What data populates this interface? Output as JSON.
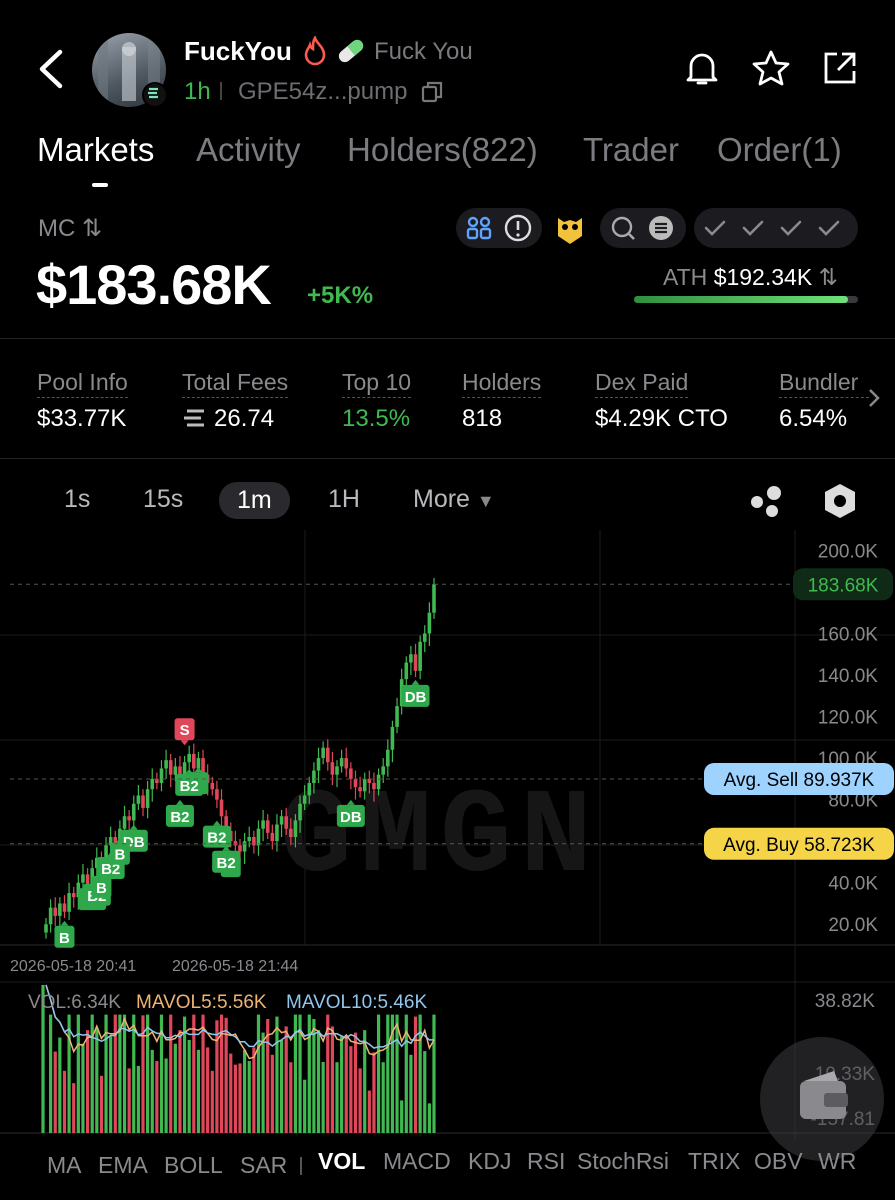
{
  "header": {
    "token_name": "FuckYou",
    "token_full_name": "Fuck You",
    "age": "1h",
    "address": "GPE54z...pump",
    "icons": [
      "back-arrow-icon",
      "bell-icon",
      "star-icon",
      "share-icon",
      "fire-icon",
      "pill-icon",
      "copy-icon",
      "solana-icon"
    ]
  },
  "tabs": [
    "Markets",
    "Activity",
    "Holders(822)",
    "Trader",
    "Order(1)"
  ],
  "market": {
    "mc_label": "MC",
    "mc_value": "$183.68K",
    "mc_change": "+5K%",
    "ath_label": "ATH",
    "ath_value": "$192.34K",
    "ath_progress": 0.955
  },
  "stats": [
    {
      "label": "Pool Info",
      "value": "$33.77K"
    },
    {
      "label": "Total Fees",
      "value": "26.74"
    },
    {
      "label": "Top 10",
      "value": "13.5%"
    },
    {
      "label": "Holders",
      "value": "818"
    },
    {
      "label": "Dex Paid",
      "value": "$4.29K CTO"
    },
    {
      "label": "Bundler",
      "value": "6.54%"
    }
  ],
  "timeframes": [
    "1s",
    "15s",
    "1m",
    "1H",
    "More"
  ],
  "active_timeframe": "1m",
  "chart_labels": {
    "current_price": "183.68K",
    "avg_sell": "Avg. Sell 89.937K",
    "avg_buy": "Avg. Buy 58.723K",
    "x_ticks": [
      "2026-05-18 20:41",
      "2026-05-18 21:44"
    ],
    "watermark": "GMGN",
    "vol_legend": {
      "vol": "VOL:6.34K",
      "mavol5": "MAVOL5:5.56K",
      "mavol10": "MAVOL10:5.46K"
    },
    "vol_axis": [
      "38.82K",
      "19.33K",
      "-157.81"
    ]
  },
  "indicators": [
    "MA",
    "EMA",
    "BOLL",
    "SAR",
    "VOL",
    "MACD",
    "KDJ",
    "RSI",
    "StochRsi",
    "TRIX",
    "OBV",
    "WR"
  ],
  "active_indicator": "VOL",
  "colors": {
    "up": "#3fb950",
    "down": "#e0475a",
    "accent_green": "#3fb950",
    "avg_sell": "#9fd3ff",
    "avg_buy": "#f5d547"
  },
  "chart_data": {
    "type": "candlestick",
    "y_ticks": [
      "200.0K",
      "160.0K",
      "140.0K",
      "120.0K",
      "100.0K",
      "80.0K",
      "40.0K",
      "20.0K"
    ],
    "ylim": [
      10,
      205
    ],
    "close_series": [
      20,
      28,
      24,
      30,
      26,
      35,
      33,
      40,
      44,
      38,
      47,
      52,
      50,
      58,
      62,
      55,
      66,
      72,
      70,
      78,
      82,
      76,
      85,
      90,
      88,
      95,
      99,
      92,
      96,
      90,
      98,
      102,
      95,
      100,
      92,
      88,
      85,
      80,
      72,
      65,
      60,
      58,
      55,
      60,
      62,
      58,
      66,
      70,
      64,
      60,
      68,
      72,
      66,
      62,
      70,
      78,
      82,
      88,
      94,
      100,
      105,
      98,
      92,
      96,
      100,
      95,
      90,
      86,
      84,
      90,
      88,
      85,
      92,
      96,
      104,
      115,
      125,
      138,
      146,
      150,
      142,
      156,
      160,
      170,
      183.68
    ],
    "markers": [
      {
        "label": "B",
        "i": 4,
        "side": "buy"
      },
      {
        "label": "B2",
        "i": 10,
        "side": "buy"
      },
      {
        "label": "B2",
        "i": 11,
        "side": "buy"
      },
      {
        "label": "B",
        "i": 12,
        "side": "buy"
      },
      {
        "label": "B2",
        "i": 14,
        "side": "buy"
      },
      {
        "label": "DB",
        "i": 19,
        "side": "buy"
      },
      {
        "label": "B",
        "i": 16,
        "side": "buy"
      },
      {
        "label": "S",
        "i": 30,
        "side": "sell"
      },
      {
        "label": "B2",
        "i": 29,
        "side": "buy"
      },
      {
        "label": "B",
        "i": 33,
        "side": "buy"
      },
      {
        "label": "B2",
        "i": 31,
        "side": "buy"
      },
      {
        "label": "B2",
        "i": 37,
        "side": "buy"
      },
      {
        "label": "B",
        "i": 40,
        "side": "buy"
      },
      {
        "label": "B2",
        "i": 39,
        "side": "buy"
      },
      {
        "label": "DB",
        "i": 66,
        "side": "buy"
      },
      {
        "label": "DB",
        "i": 80,
        "side": "buy"
      }
    ]
  }
}
